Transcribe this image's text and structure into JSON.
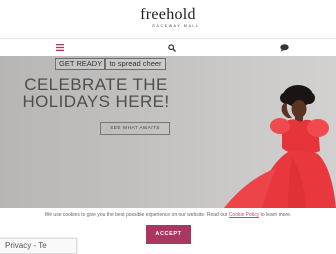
{
  "header": {
    "logo_main": "freehold",
    "logo_sub": "RACEWAY MALL"
  },
  "navbar": {
    "menu_icon": "hamburger-menu-icon",
    "search_icon": "search-icon",
    "chat_icon": "chat-bubble-icon"
  },
  "hero": {
    "tag_1": "GET READY",
    "tag_2": "to spread cheer",
    "headline_line1": "CELEBRATE THE",
    "headline_line2": "HOLIDAYS HERE!",
    "cta_label": "SEE WHAT AWAITS"
  },
  "cookie_banner": {
    "text_before": "We use cookies to give you the best possible experience on our website. Read our ",
    "link_label": "Cookie Policy",
    "text_after": " to learn more.",
    "accept_label": "ACCEPT"
  },
  "recaptcha": {
    "label": "Privacy - Te"
  },
  "colors": {
    "accent": "#a8385f",
    "link": "#c04b76",
    "dress": "#e5343a"
  }
}
